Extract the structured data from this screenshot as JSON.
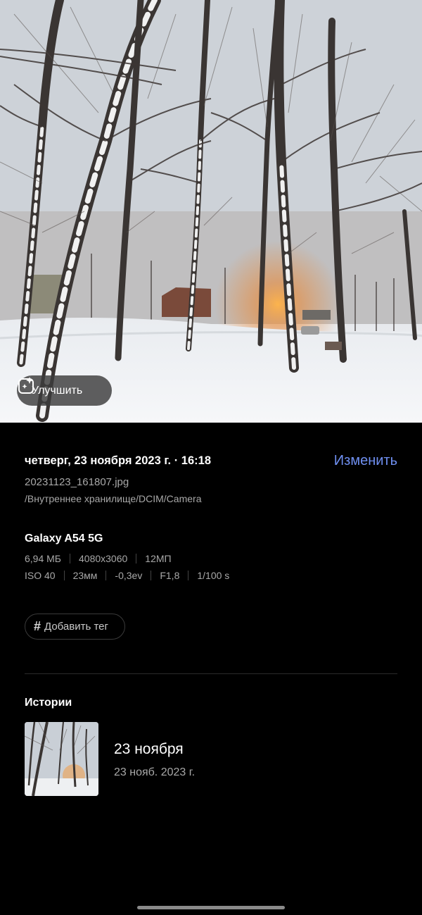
{
  "photo": {
    "enhance_label": "Улучшить"
  },
  "details": {
    "datetime": "четверг, 23 ноября 2023 г. · 16:18",
    "edit_label": "Изменить",
    "filename": "20231123_161807.jpg",
    "path": "/Внутреннее хранилище/DCIM/Camera",
    "device": "Galaxy A54 5G",
    "specs_row1": [
      "6,94 МБ",
      "4080x3060",
      "12МП"
    ],
    "specs_row2": [
      "ISO 40",
      "23мм",
      "-0,3ev",
      "F1,8",
      "1/100 s"
    ],
    "tag_button_label": "Добавить тег",
    "tag_icon": "hash-icon"
  },
  "stories": {
    "title": "Истории",
    "items": [
      {
        "title": "23 ноября",
        "date": "23 нояб. 2023 г."
      }
    ]
  },
  "colors": {
    "accent": "#6f8ff0",
    "background": "#000000",
    "secondary_text": "#a8a8a8"
  }
}
